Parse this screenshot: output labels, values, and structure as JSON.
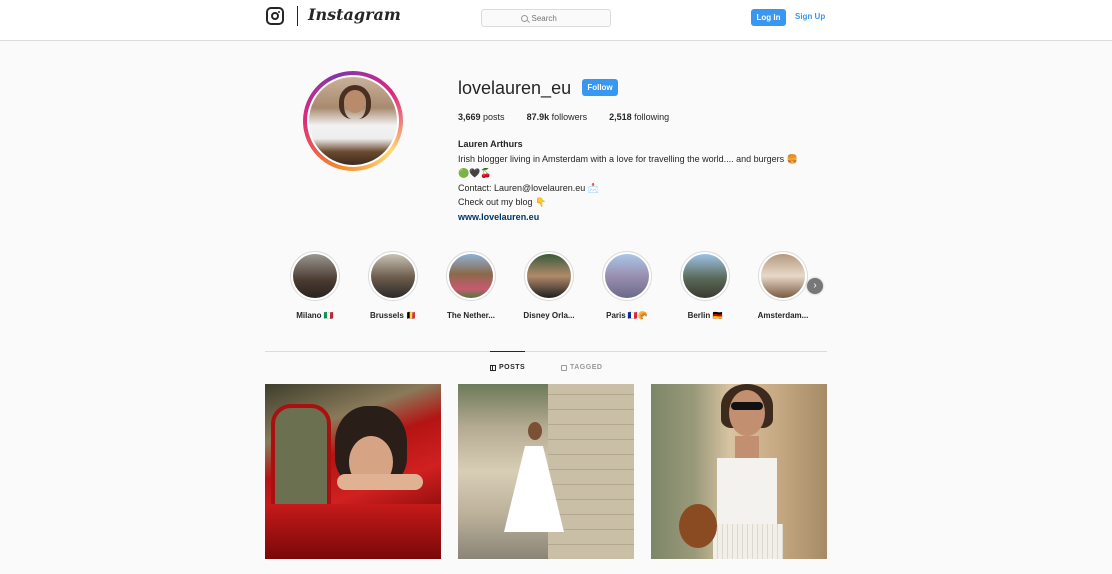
{
  "header": {
    "logo_text": "Instagram",
    "search_placeholder": "Search",
    "login_label": "Log In",
    "signup_label": "Sign Up"
  },
  "profile": {
    "username": "lovelauren_eu",
    "follow_label": "Follow",
    "posts_count": "3,669",
    "posts_label": "posts",
    "followers_count": "87.9k",
    "followers_label": "followers",
    "following_count": "2,518",
    "following_label": "following",
    "full_name": "Lauren Arthurs",
    "bio_line1": "Irish blogger living in Amsterdam with a love for travelling the world.... and burgers 🍔",
    "bio_line2": "🟢🖤🍒",
    "bio_line3": "Contact: Lauren@lovelauren.eu 📩",
    "bio_line4": "Check out my blog 👇",
    "website": "www.lovelauren.eu"
  },
  "highlights": [
    {
      "label": "Milano 🇮🇹"
    },
    {
      "label": "Brussels 🇧🇪"
    },
    {
      "label": "The Nether..."
    },
    {
      "label": "Disney Orla..."
    },
    {
      "label": "Paris 🇫🇷🥐"
    },
    {
      "label": "Berlin 🇩🇪"
    },
    {
      "label": "Amsterdam..."
    }
  ],
  "tabs": {
    "posts": "POSTS",
    "tagged": "TAGGED"
  },
  "colors": {
    "accent": "#3897f0",
    "link": "#003569",
    "text": "#262626",
    "background": "#fafafa"
  }
}
